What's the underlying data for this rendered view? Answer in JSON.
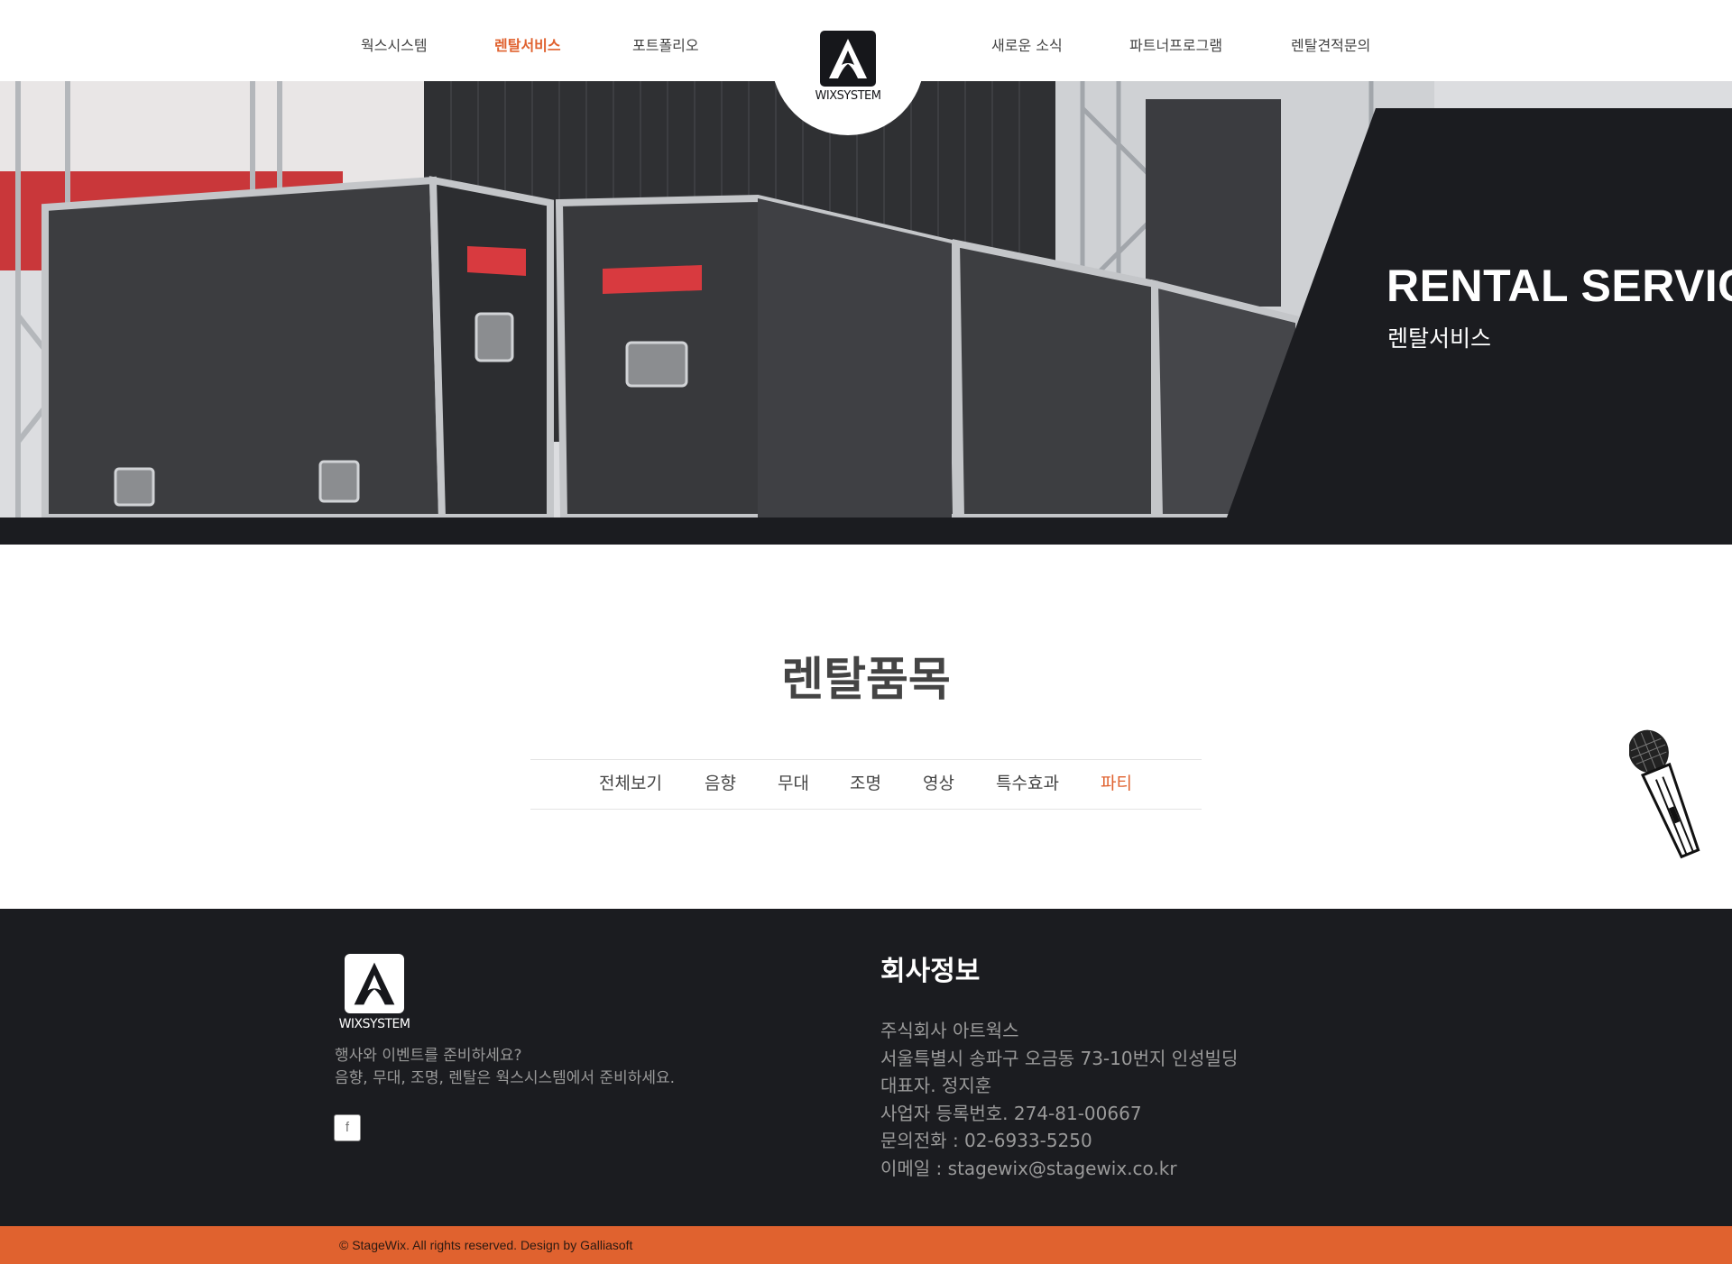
{
  "nav": {
    "left": [
      "웍스시스템",
      "렌탈서비스",
      "포트폴리오"
    ],
    "right": [
      "새로운 소식",
      "파트너프로그램",
      "렌탈견적문의"
    ],
    "active": "렌탈서비스",
    "logo_text": "WIXSYSTEM"
  },
  "hero": {
    "title": "RENTAL SERVICE",
    "subtitle": "렌탈서비스"
  },
  "main": {
    "title": "렌탈품목",
    "tabs": [
      "전체보기",
      "음향",
      "무대",
      "조명",
      "영상",
      "특수효과",
      "파티"
    ],
    "active_tab": "파티"
  },
  "footer": {
    "logo_text": "WIXSYSTEM",
    "desc_line1": "행사와 이벤트를 준비하세요?",
    "desc_line2": "음향, 무대, 조명, 렌탈은 웍스시스템에서 준비하세요.",
    "facebook_icon": "f",
    "info_title": "회사정보",
    "info": [
      "주식회사 아트웍스",
      "서울특별시 송파구 오금동 73-10번지 인성빌딩",
      "대표자. 정지훈",
      "사업자 등록번호. 274-81-00667",
      "문의전화 : 02-6933-5250",
      "이메일 : stagewix@stagewix.co.kr"
    ],
    "copyright": "© StageWix. All rights reserved. Design by Galliasoft"
  },
  "colors": {
    "accent": "#e0622f",
    "dark": "#1b1c20"
  }
}
